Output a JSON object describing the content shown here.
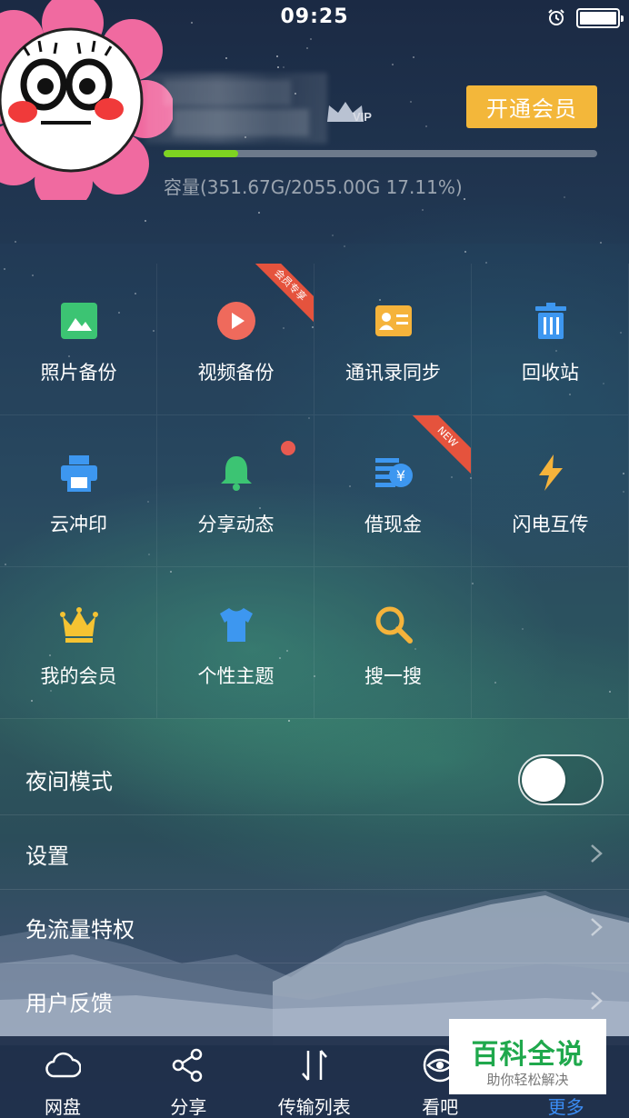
{
  "status_bar": {
    "time": "09:25"
  },
  "profile": {
    "vip_badge": "VIP",
    "vip_button": "开通会员",
    "storage_used_fraction": 0.1711,
    "capacity_text": "容量(351.67G/2055.00G 17.11%)"
  },
  "grid": {
    "items": [
      {
        "label": "照片备份",
        "icon": "photo-icon",
        "color": "#3cc473"
      },
      {
        "label": "视频备份",
        "icon": "play-icon",
        "color": "#ef6a5c",
        "ribbon": "会员专享"
      },
      {
        "label": "通讯录同步",
        "icon": "contact-card-icon",
        "color": "#f5b33b"
      },
      {
        "label": "回收站",
        "icon": "trash-icon",
        "color": "#3d97f0"
      },
      {
        "label": "云冲印",
        "icon": "printer-icon",
        "color": "#3d97f0"
      },
      {
        "label": "分享动态",
        "icon": "bell-icon",
        "color": "#3cc473",
        "has_dot": true
      },
      {
        "label": "借现金",
        "icon": "cash-icon",
        "color": "#3d97f0",
        "ribbon": "NEW"
      },
      {
        "label": "闪电互传",
        "icon": "lightning-icon",
        "color": "#f5b33b"
      },
      {
        "label": "我的会员",
        "icon": "crown-icon",
        "color": "#f5c332"
      },
      {
        "label": "个性主题",
        "icon": "tshirt-icon",
        "color": "#3d97f0"
      },
      {
        "label": "搜一搜",
        "icon": "search-icon",
        "color": "#f5b33b"
      }
    ]
  },
  "list": {
    "night_mode": "夜间模式",
    "night_mode_on": false,
    "settings": "设置",
    "free_traffic": "免流量特权",
    "feedback": "用户反馈"
  },
  "tab_bar": {
    "tabs": [
      {
        "label": "网盘",
        "icon": "cloud-icon"
      },
      {
        "label": "分享",
        "icon": "share-icon"
      },
      {
        "label": "传输列表",
        "icon": "transfer-icon"
      },
      {
        "label": "看吧",
        "icon": "eye-icon"
      },
      {
        "label": "更多",
        "icon": "more-icon",
        "active": true
      }
    ]
  },
  "watermark": {
    "main": "百科全说",
    "sub": "助你轻松解决"
  }
}
